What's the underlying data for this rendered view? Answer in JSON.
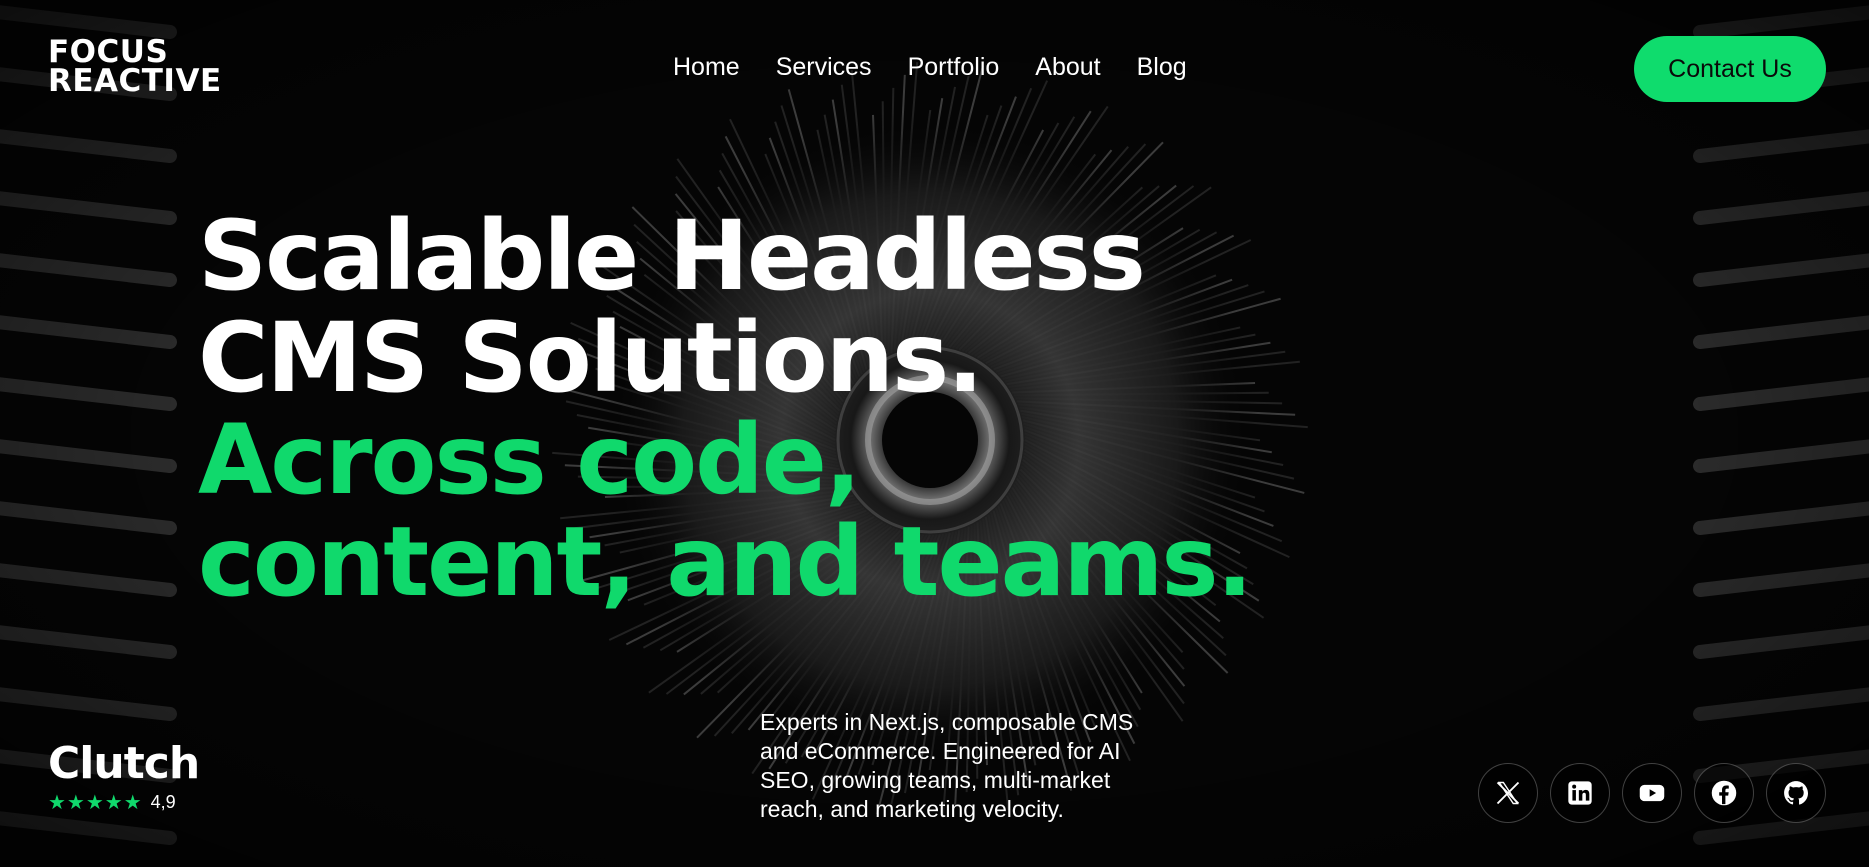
{
  "header": {
    "logo_line1": "FOCUS",
    "logo_line2": "REACTIVE",
    "nav": [
      "Home",
      "Services",
      "Portfolio",
      "About",
      "Blog"
    ],
    "cta_label": "Contact Us"
  },
  "hero": {
    "line1": "Scalable Headless",
    "line2": "CMS Solutions.",
    "line3": "Across code,",
    "line4": "content, and teams."
  },
  "description": "Experts in Next.js, composable CMS and eCommerce. Engineered for AI SEO, growing teams, multi-market reach, and marketing velocity.",
  "clutch": {
    "brand": "Clutch",
    "stars": "★★★★★",
    "score": "4,9"
  },
  "socials": [
    "x-icon",
    "linkedin-icon",
    "youtube-icon",
    "facebook-icon",
    "github-icon"
  ],
  "colors": {
    "accent": "#10d96c",
    "background": "#000000",
    "text": "#ffffff"
  }
}
